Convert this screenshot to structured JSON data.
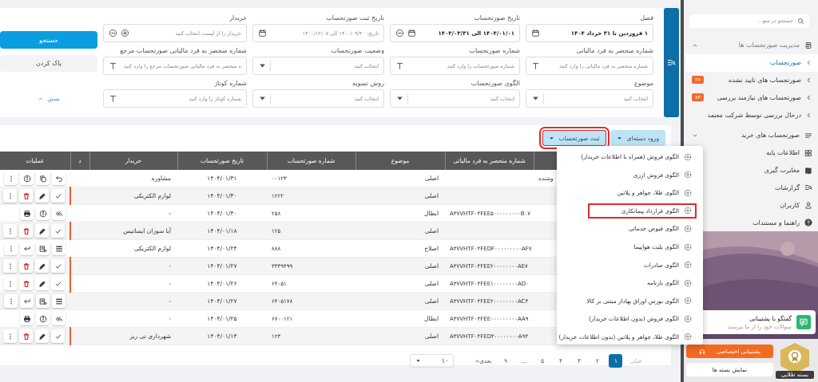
{
  "filters": {
    "fields": [
      {
        "label": "فصل",
        "kind": "date",
        "value": "۱ فروردین تا ۳۱ خرداد ۱۴۰۴"
      },
      {
        "label": "تاریخ صورتحساب",
        "kind": "date-clear",
        "value": "۱۴۰۴/۰۱/۰۱ الی ۱۴۰۴/۰۳/۳۱"
      },
      {
        "label": "تاریخ ثبت صورتحساب",
        "kind": "date",
        "placeholder": "تاریخ: ۱۴۰۰/۰۹/۳۰ الی ۱۴۰۰/۱۲/۰۷"
      },
      {
        "label": "خریدار",
        "kind": "picker",
        "placeholder": "خریدار را از لیست انتخاب کنید"
      },
      {
        "label": "شماره منحصر به فرد مالیاتی",
        "kind": "text",
        "placeholder": "شماره منحصر به فرد مالیاتی را وارد کنید"
      },
      {
        "label": "شماره صورتحساب",
        "kind": "text",
        "placeholder": "شماره صورتحساب را وارد کنید"
      },
      {
        "label": "وضعیت صورتحساب",
        "kind": "select",
        "placeholder": "انتخاب کنید"
      },
      {
        "label": "شماره منحصر به فرد مالیاتی صورتحساب مرجع",
        "kind": "text",
        "placeholder": "ه منحصر به فرد مالیاتی صورتحساب مرجع را وارد کنید"
      },
      {
        "label": "موضوع",
        "kind": "select",
        "placeholder": "انتخاب کنید"
      },
      {
        "label": "الگوی صورتحساب",
        "kind": "select",
        "placeholder": "انتخاب کنید"
      },
      {
        "label": "روش تسویه",
        "kind": "select",
        "placeholder": "انتخاب کنید"
      },
      {
        "label": "شماره کوتاژ",
        "kind": "text",
        "placeholder": "شماره کوتاژ را وارد کنید"
      }
    ],
    "search_button": "جستجو",
    "clear_button": "پاک کردن",
    "collapse_link": "بستن"
  },
  "toolbar": {
    "buttons": [
      {
        "label": "ورود دسته‌ای",
        "highlighted": false
      },
      {
        "label": "ثبت صورتحساب",
        "highlighted": true
      }
    ]
  },
  "menu": {
    "items": [
      {
        "label": "الگوی فروش (همراه با اطلاعات خریدار)",
        "highlighted": false
      },
      {
        "label": "الگوی فروش ارزی",
        "highlighted": false
      },
      {
        "label": "الگوی طلا، جواهر و پلاتین",
        "highlighted": false
      },
      {
        "label": "الگوی قرارداد پیمانکاری",
        "highlighted": true
      },
      {
        "label": "الگوی قبوض خدماتی",
        "highlighted": false
      },
      {
        "label": "الگوی بلیت هواپیما",
        "highlighted": false
      },
      {
        "label": "الگوی صادرات",
        "highlighted": false
      },
      {
        "label": "الگوی بارنامه",
        "highlighted": false
      },
      {
        "label": "الگوی بورس اوراق بهادار مبتنی بر کالا",
        "highlighted": false
      },
      {
        "label": "الگوی فروش (بدون اطلاعات خریدار)",
        "highlighted": false
      },
      {
        "label": "الگوی طلا، جواهر و پلاتین (بدون اطلاعات خریدار)",
        "highlighted": false
      }
    ]
  },
  "table": {
    "columns": [
      "شماره منحصر به فرد مالیاتی",
      "موضوع",
      "شماره صورتحساب",
      "تاریخ صورتحساب",
      "خریدار",
      "د",
      "عملیات"
    ],
    "rows": [
      {
        "column_1": "وشنده",
        "tax_id": "",
        "subject": "اصلی",
        "number": "۰۰۱۲۳",
        "date": "۱۴۰۴/۰۱/۳۱",
        "buyer": "مشاوره",
        "kind": "returned"
      },
      {
        "tax_id": "",
        "subject": "اصلی",
        "number": "۱۲۲۲",
        "date": "۱۴۰۴/۰۱/۳۰",
        "buyer": "لوازم الکتریکی",
        "kind": "editable"
      },
      {
        "tax_id": "A۳۷VHTF۰۴FEE۵۰۰۰۰۰۰۰۰۰B۰۷",
        "subject": "ابطال",
        "number": "۲۵۸",
        "date": "۱۴۰۴/۰۱/۳۰",
        "buyer": "-",
        "kind": "sent"
      },
      {
        "tax_id": "",
        "subject": "اصلی",
        "number": "۱۲۵",
        "date": "۱۴۰۴/۰۱/۱۸",
        "buyer": "آیا سوزان ایساتیس",
        "kind": "editable"
      },
      {
        "tax_id": "A۳۷VHTF۰۴FEDF۰۰۰۰۰۰۰۰۰AF۷",
        "subject": "اصلاح",
        "number": "۸۸۸",
        "date": "۱۴۰۴/۰۱/۲۴",
        "buyer": "لوازم الکتریکی",
        "kind": "accepted"
      },
      {
        "tax_id": "A۳۷VHTF۰۴FEE۲۰۰۰۰۰۰۰۰AE۷",
        "subject": "اصلی",
        "number": "۳۳۳۹۴۹۹",
        "date": "۱۴۰۴/۰۱/۲۷",
        "buyer": "-",
        "kind": "editable"
      },
      {
        "tax_id": "A۳۷VHTF۰۴FEE۱۰۰۰۰۰۰۰۰AD۰",
        "subject": "اصلی",
        "number": "۶۴۰۵۱",
        "date": "۱۴۰۴/۰۱/۲۶",
        "buyer": "-",
        "kind": "editable"
      },
      {
        "tax_id": "A۳۷VHTF۰۴FEE۲۰۰۰۰۰۰۰۰AC۳",
        "subject": "اصلی",
        "number": "۶۴۰۵۱۷۸",
        "date": "۱۴۰۴/۰۱/۲۷",
        "buyer": "-",
        "kind": "accepted"
      },
      {
        "tax_id": "A۳۷VHTF۰۴FEE۰۰۰۰۰۰۰۰۰AA۹",
        "subject": "ابطال",
        "number": "۶۷۰۰۱۲۱",
        "date": "۱۴۰۴/۰۱/۲۵",
        "buyer": "-",
        "kind": "sent"
      },
      {
        "tax_id": "A۳۷VHTF۰۴FED۴۰۰۰۰۰۰۰۰A۹۴",
        "subject": "اصلی",
        "number": "۱۲۳",
        "date": "۱۴۰۴/۰۱/۱۳",
        "buyer": "شهرداری نی ریز",
        "kind": "editable"
      }
    ]
  },
  "pagination": {
    "previous": {
      "label": "قبلی",
      "disabled": true
    },
    "items": [
      {
        "kind": "page",
        "label": "۱",
        "selected": true
      },
      {
        "kind": "page",
        "label": "۲",
        "selected": false
      },
      {
        "kind": "page",
        "label": "۳",
        "selected": false
      },
      {
        "kind": "page",
        "label": "۴",
        "selected": false
      },
      {
        "kind": "page",
        "label": "۵",
        "selected": false
      },
      {
        "kind": "ellipsis",
        "label": "..."
      },
      {
        "kind": "page",
        "label": "۹",
        "selected": false
      }
    ],
    "next": {
      "label": "بعدی«",
      "disabled": false
    },
    "page_size": "۱۰"
  },
  "sidebar": {
    "search": {
      "placeholder": "جستجو در منو..."
    },
    "items": [
      {
        "label": "مدیریت صورتحساب ها",
        "expanded": true,
        "selected": false,
        "children": [
          {
            "label": "صورتحساب",
            "selected": true
          },
          {
            "label": "صورتحساب های تایید نشده",
            "selected": false,
            "badge": "۲۶"
          },
          {
            "label": "صورتحساب های نیازمند بررسی",
            "selected": false,
            "badge": "۸۴"
          },
          {
            "label": "درحال بررسی توسط شرکت معتمد",
            "selected": false
          }
        ]
      },
      {
        "label": "صورتحساب های خرید",
        "expanded": false,
        "selected": false
      },
      {
        "label": "اطلاعات پایه",
        "selected": false
      },
      {
        "label": "مغایرت گیری",
        "selected": false
      },
      {
        "label": "گزارشات",
        "selected": false
      },
      {
        "label": "کاربران",
        "selected": false
      },
      {
        "label": "راهنما و مستندات",
        "selected": false
      }
    ],
    "support_chat": {
      "title": "گفتگو با پشتیبانی",
      "subtitle": "سوالات خود را از ما بپرسید"
    },
    "plan": {
      "badge": "بسته طلایی",
      "support_button": "پشتیبانی اختصاصی",
      "plans_button": "نمایش بسته ها"
    }
  }
}
